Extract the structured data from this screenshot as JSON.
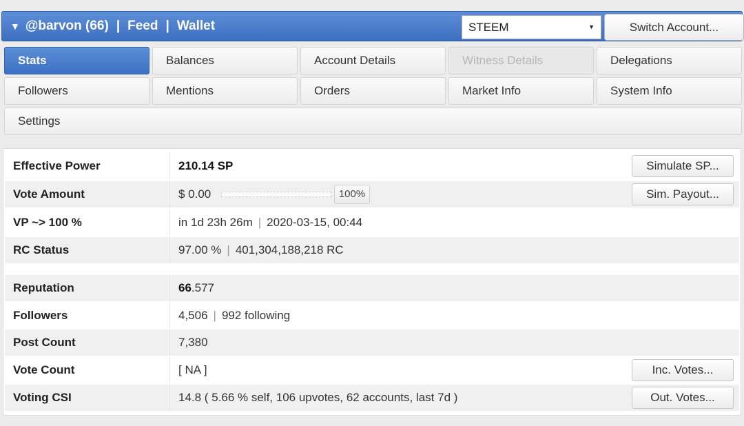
{
  "header": {
    "account": "@barvon (66)",
    "feed": "Feed",
    "wallet": "Wallet",
    "currency_select": "STEEM",
    "switch_account": "Switch Account..."
  },
  "tabs": [
    {
      "label": "Stats",
      "active": true
    },
    {
      "label": "Balances"
    },
    {
      "label": "Account Details"
    },
    {
      "label": "Witness Details",
      "disabled": true
    },
    {
      "label": "Delegations"
    },
    {
      "label": "Followers"
    },
    {
      "label": "Mentions"
    },
    {
      "label": "Orders"
    },
    {
      "label": "Market Info"
    },
    {
      "label": "System Info"
    },
    {
      "label": "Settings"
    }
  ],
  "stats": {
    "effective_power": {
      "label": "Effective Power",
      "value": "210.14 SP",
      "button": "Simulate SP..."
    },
    "vote_amount": {
      "label": "Vote Amount",
      "value": "$ 0.00",
      "percent": "100%",
      "slider_level": 1.0,
      "button": "Sim. Payout..."
    },
    "vp": {
      "label": "VP ~> 100 %",
      "time": "in 1d 23h 26m",
      "date": "2020-03-15, 00:44"
    },
    "rc_status": {
      "label": "RC Status",
      "percent": "97.00 %",
      "rc": "401,304,188,218 RC"
    },
    "reputation": {
      "label": "Reputation",
      "whole": "66",
      "fraction": ".577"
    },
    "followers": {
      "label": "Followers",
      "count": "4,506",
      "following": "992 following"
    },
    "post_count": {
      "label": "Post Count",
      "value": "7,380"
    },
    "vote_count": {
      "label": "Vote Count",
      "value": "[ NA ]",
      "button": "Inc. Votes..."
    },
    "voting_csi": {
      "label": "Voting CSI",
      "value": "14.8 ( 5.66 % self, 106 upvotes, 62 accounts, last 7d )",
      "button": "Out. Votes..."
    }
  },
  "colors": {
    "header_blue": "#4a7fcd",
    "active_tab": "#4a7fcd"
  }
}
